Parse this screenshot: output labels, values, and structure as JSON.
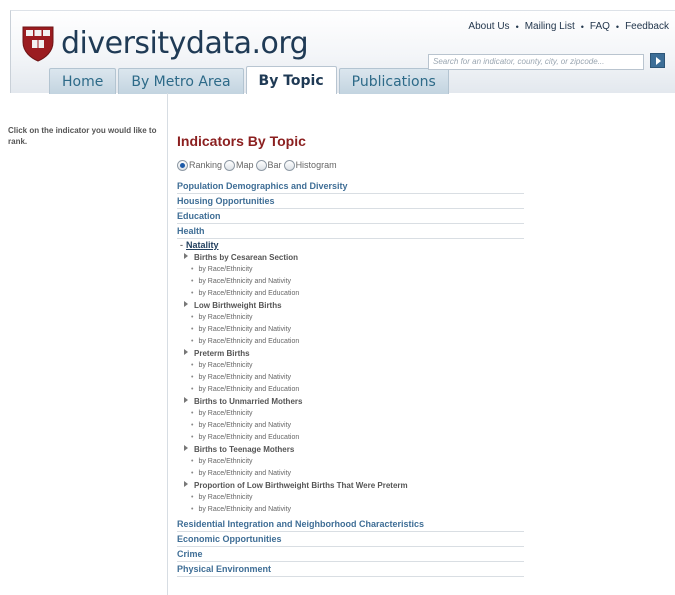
{
  "header": {
    "logo_text": "diversitydata.org",
    "top_links": [
      "About Us",
      "Mailing List",
      "FAQ",
      "Feedback"
    ],
    "tabs": [
      {
        "label": "Home",
        "active": false
      },
      {
        "label": "By Metro Area",
        "active": false
      },
      {
        "label": "By Topic",
        "active": true
      },
      {
        "label": "Publications",
        "active": false
      }
    ],
    "search_placeholder": "Search for an indicator, county, city, or zipcode..."
  },
  "sidebar": {
    "instructions": "Click on the indicator you would like to rank."
  },
  "main": {
    "title": "Indicators By Topic",
    "view_options": [
      {
        "label": "Ranking",
        "selected": true
      },
      {
        "label": "Map",
        "selected": false
      },
      {
        "label": "Bar",
        "selected": false
      },
      {
        "label": "Histogram",
        "selected": false
      }
    ],
    "topics_before": [
      "Population Demographics and Diversity",
      "Housing Opportunities",
      "Education",
      "Health"
    ],
    "expanded_subtopic": "Natality",
    "indicators": [
      {
        "name": "Births by Cesarean Section",
        "breakdowns": [
          "by Race/Ethnicity",
          "by Race/Ethnicity and Nativity",
          "by Race/Ethnicity and Education"
        ]
      },
      {
        "name": "Low Birthweight Births",
        "breakdowns": [
          "by Race/Ethnicity",
          "by Race/Ethnicity and Nativity",
          "by Race/Ethnicity and Education"
        ]
      },
      {
        "name": "Preterm Births",
        "breakdowns": [
          "by Race/Ethnicity",
          "by Race/Ethnicity and Nativity",
          "by Race/Ethnicity and Education"
        ]
      },
      {
        "name": "Births to Unmarried Mothers",
        "breakdowns": [
          "by Race/Ethnicity",
          "by Race/Ethnicity and Nativity",
          "by Race/Ethnicity and Education"
        ]
      },
      {
        "name": "Births to Teenage Mothers",
        "breakdowns": [
          "by Race/Ethnicity",
          "by Race/Ethnicity and Nativity"
        ]
      },
      {
        "name": "Proportion of Low Birthweight Births That Were Preterm",
        "breakdowns": [
          "by Race/Ethnicity",
          "by Race/Ethnicity and Nativity"
        ]
      }
    ],
    "topics_after": [
      "Residential Integration and Neighborhood Characteristics",
      "Economic Opportunities",
      "Crime",
      "Physical Environment"
    ]
  }
}
